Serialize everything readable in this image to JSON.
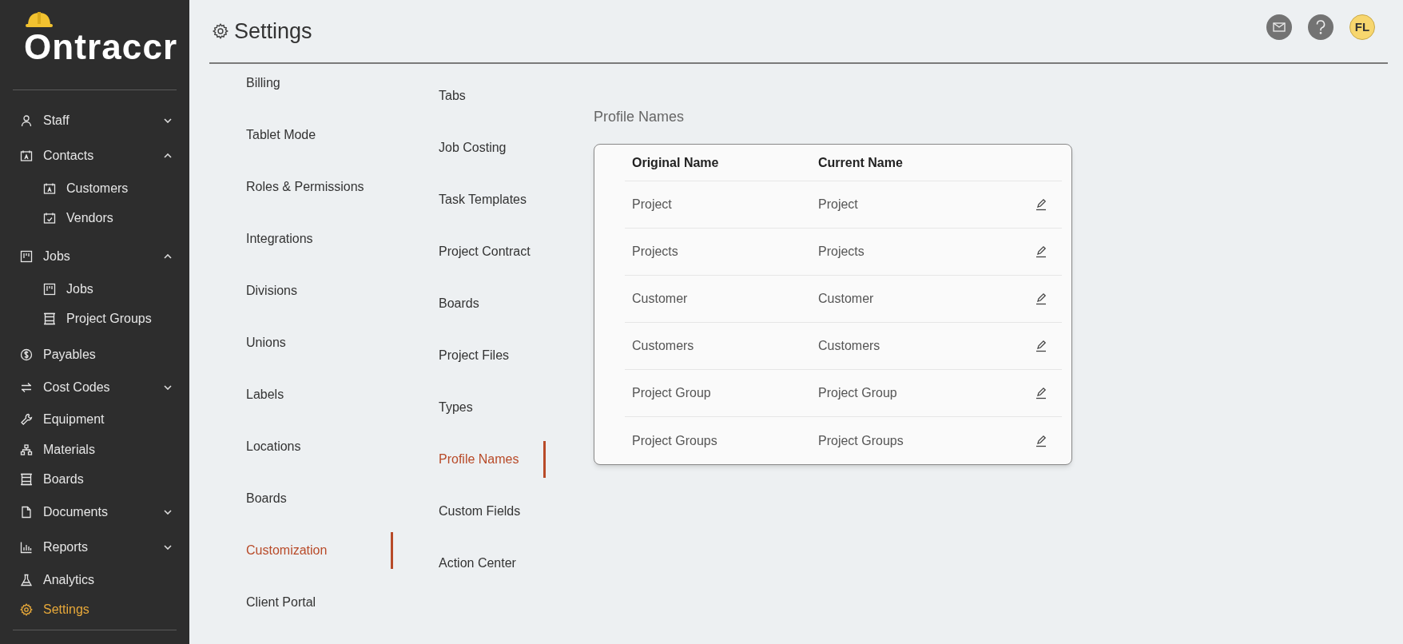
{
  "sidebar": {
    "logo": "Ontraccr",
    "items": [
      {
        "label": "Staff",
        "kind": "group",
        "expanded": false,
        "selected": false
      },
      {
        "label": "Contacts",
        "kind": "group",
        "expanded": true,
        "selected": false,
        "children": [
          {
            "label": "Customers",
            "selected": false
          },
          {
            "label": "Vendors",
            "selected": false
          }
        ]
      },
      {
        "label": "Jobs",
        "kind": "group",
        "expanded": true,
        "selected": false,
        "children": [
          {
            "label": "Jobs",
            "selected": false
          },
          {
            "label": "Project Groups",
            "selected": false
          }
        ]
      },
      {
        "label": "Payables",
        "kind": "link",
        "selected": false
      },
      {
        "label": "Cost Codes",
        "kind": "group",
        "expanded": false,
        "selected": false
      },
      {
        "label": "Equipment",
        "kind": "link",
        "selected": false
      },
      {
        "label": "Materials",
        "kind": "link",
        "selected": false
      },
      {
        "label": "Boards",
        "kind": "link",
        "selected": false
      },
      {
        "label": "Documents",
        "kind": "group",
        "expanded": false,
        "selected": false
      },
      {
        "label": "Reports",
        "kind": "group",
        "expanded": false,
        "selected": false
      },
      {
        "label": "Analytics",
        "kind": "link",
        "selected": false
      },
      {
        "label": "Settings",
        "kind": "link",
        "selected": true
      }
    ]
  },
  "header": {
    "title": "Settings",
    "avatar": "FL"
  },
  "settings_menu": [
    {
      "label": "Billing",
      "selected": false
    },
    {
      "label": "Tablet Mode",
      "selected": false
    },
    {
      "label": "Roles & Permissions",
      "selected": false
    },
    {
      "label": "Integrations",
      "selected": false
    },
    {
      "label": "Divisions",
      "selected": false
    },
    {
      "label": "Unions",
      "selected": false
    },
    {
      "label": "Labels",
      "selected": false
    },
    {
      "label": "Locations",
      "selected": false
    },
    {
      "label": "Boards",
      "selected": false
    },
    {
      "label": "Customization",
      "selected": true
    },
    {
      "label": "Client Portal",
      "selected": false
    }
  ],
  "customization_menu": [
    {
      "label": "Tabs",
      "selected": false
    },
    {
      "label": "Job Costing",
      "selected": false
    },
    {
      "label": "Task Templates",
      "selected": false
    },
    {
      "label": "Project Contract",
      "selected": false
    },
    {
      "label": "Boards",
      "selected": false
    },
    {
      "label": "Project Files",
      "selected": false
    },
    {
      "label": "Types",
      "selected": false
    },
    {
      "label": "Profile Names",
      "selected": true
    },
    {
      "label": "Custom Fields",
      "selected": false
    },
    {
      "label": "Action Center",
      "selected": false
    }
  ],
  "profile_names": {
    "title": "Profile Names",
    "columns": [
      "Original Name",
      "Current Name"
    ],
    "rows": [
      {
        "original": "Project",
        "current": "Project"
      },
      {
        "original": "Projects",
        "current": "Projects"
      },
      {
        "original": "Customer",
        "current": "Customer"
      },
      {
        "original": "Customers",
        "current": "Customers"
      },
      {
        "original": "Project Group",
        "current": "Project Group"
      },
      {
        "original": "Project Groups",
        "current": "Project Groups"
      }
    ]
  }
}
